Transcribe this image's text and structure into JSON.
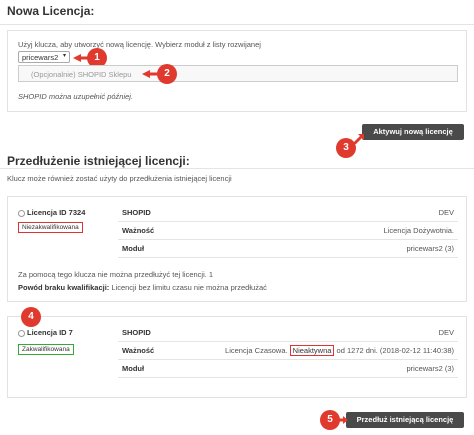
{
  "new_license": {
    "heading": "Nowa Licencja:",
    "instruction": "Użyj klucza, aby utworzyć nową licencję. Wybierz moduł z listy rozwijanej",
    "module_select": "pricewars2",
    "shopid_placeholder": "(Opcjonalnie) SHOPID Sklepu",
    "shopid_note": "SHOPID można uzupełnić później.",
    "activate_button": "Aktywuj nową licencję"
  },
  "extend_license": {
    "heading": "Przedłużenie istniejącej licencji:",
    "description": "Klucz może również zostać użyty do przedłużenia istniejącej licencji",
    "licenses": [
      {
        "id_label": "Licencja ID 7324",
        "status": "Niezakwalifikowana",
        "status_color": "#dd3333",
        "rows": [
          {
            "key": "SHOPID",
            "value": "DEV"
          },
          {
            "key": "Ważność",
            "value": "Licencja Dożywotnia."
          },
          {
            "key": "Moduł",
            "value": "pricewars2 (3)"
          }
        ],
        "note": "Za pomocą tego klucza nie można przedłużyć tej licencji. 1",
        "reason_label": "Powód braku kwalifikacji:",
        "reason_text": "Licencji bez limitu czasu nie można przedłużać"
      },
      {
        "id_label": "Licencja ID 7",
        "status": "Zakwalifikowana",
        "status_color": "#33aa33",
        "rows": [
          {
            "key": "SHOPID",
            "value": "DEV"
          },
          {
            "key": "Ważność",
            "value_prefix": "Licencja Czasowa.",
            "value_badge": "Nieaktywna",
            "value_suffix": "od 1272 dni. (2018-02-12 11:40:38)"
          },
          {
            "key": "Moduł",
            "value": "pricewars2 (3)"
          }
        ]
      }
    ],
    "extend_button": "Przedłuż istniejącą licencję"
  },
  "markers": [
    "1",
    "2",
    "3",
    "4",
    "5"
  ],
  "colors": {
    "marker": "#e03a2e",
    "button": "#4a4a4a"
  }
}
